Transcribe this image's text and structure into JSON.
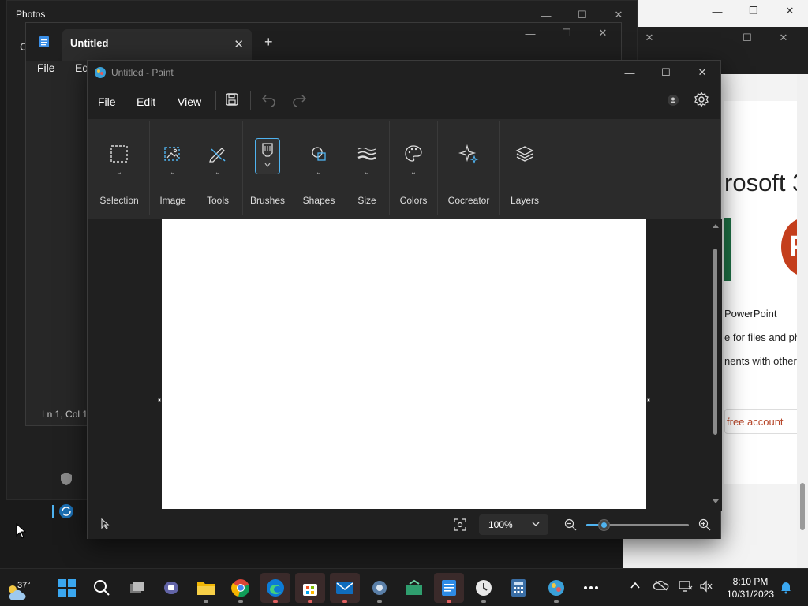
{
  "photos": {
    "title": "Photos",
    "partial_text": "C"
  },
  "notepad": {
    "tab_title": "Untitled",
    "menu": {
      "file": "File",
      "edit": "Ed"
    },
    "status": "Ln 1, Col 1"
  },
  "paint": {
    "title": "Untitled - Paint",
    "menu": {
      "file": "File",
      "edit": "Edit",
      "view": "View"
    },
    "ribbon": [
      {
        "label": "Selection",
        "icon": "selection-icon"
      },
      {
        "label": "Image",
        "icon": "image-icon"
      },
      {
        "label": "Tools",
        "icon": "tools-icon"
      },
      {
        "label": "Brushes",
        "icon": "brush-icon"
      },
      {
        "label": "Shapes",
        "icon": "shapes-icon"
      },
      {
        "label": "Size",
        "icon": "size-icon"
      },
      {
        "label": "Colors",
        "icon": "palette-icon"
      },
      {
        "label": "Cocreator",
        "icon": "sparkle-icon"
      },
      {
        "label": "Layers",
        "icon": "layers-icon"
      }
    ],
    "zoom": "100%",
    "zoom_slider_level": 0.17,
    "accent": "#4fb3f0"
  },
  "browser": {
    "heading": "rosoft 3",
    "logo_letter": "P",
    "lines": [
      "PowerPoint",
      "e for files and ph",
      "nents with others"
    ],
    "account_button": "free account",
    "accent": "#c43e1c"
  },
  "taskbar": {
    "weather_temp": "37°",
    "clock_time": "8:10 PM",
    "clock_date": "10/31/2023",
    "apps": [
      "start-icon",
      "search-icon",
      "task-view-icon",
      "teams-icon",
      "file-explorer-icon",
      "chrome-icon",
      "edge-icon",
      "store-icon",
      "mail-icon",
      "settings-icon",
      "media-icon",
      "notepad-icon",
      "clock-icon",
      "calculator-icon",
      "paint-icon",
      "more-icon"
    ]
  }
}
